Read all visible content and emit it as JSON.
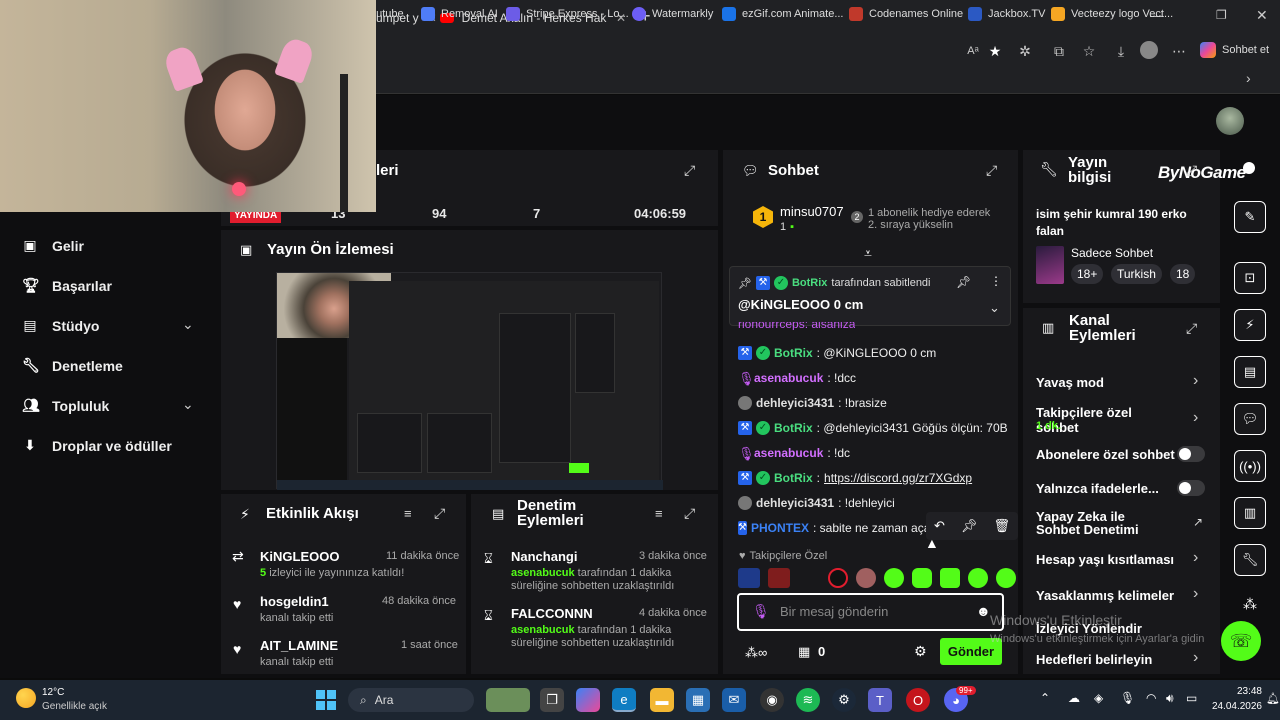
{
  "browser": {
    "tabs": [
      {
        "label": "umpet y"
      },
      {
        "label": "Demet Akalın - Herkes Hak Ettiği G"
      }
    ],
    "copilot_label": "Sohbet et",
    "bookmarks": [
      "outube",
      "Removal.AI",
      "Stripe Express - Lo...",
      "Watermarkly",
      "ezGif.com Animate...",
      "Codenames Online",
      "Jackbox.TV",
      "Vecteezy logo Vect..."
    ]
  },
  "sidebar": {
    "items": [
      {
        "label": "Gelir"
      },
      {
        "label": "Başarılar"
      },
      {
        "label": "Stüdyo"
      },
      {
        "label": "Denetleme"
      },
      {
        "label": "Topluluk"
      },
      {
        "label": "Droplar ve ödüller"
      }
    ]
  },
  "stats": {
    "title": "leri",
    "live_badge": "YAYINDA",
    "values": [
      "13",
      "94",
      "7",
      "04:06:59"
    ]
  },
  "preview": {
    "title": "Yayın Ön İzlemesi"
  },
  "chat": {
    "title": "Sohbet",
    "leader_name": "minsu0707",
    "leader_count": "1",
    "leader_rank": "1",
    "gift_line1": "1 abonelik hediye ederek",
    "gift_line2": "2. sıraya yükselin",
    "pinned_by": "BotRix",
    "pinned_suffix": "tarafından sabitlendi",
    "pinned_message": "@KiNGLEOOO 0 cm",
    "partial_line": "rionourrceps: alsaniza",
    "messages": [
      {
        "user": "BotRix",
        "text": ": @KiNGLEOOO 0 cm",
        "kind": "bot"
      },
      {
        "user": "asenabucuk",
        "text": ": !dcc",
        "kind": "pink"
      },
      {
        "user": "dehleyici3431",
        "text": ": !brasize",
        "kind": "white"
      },
      {
        "user": "BotRix",
        "text": ": @dehleyici3431 Göğüs ölçün: 70B",
        "kind": "bot"
      },
      {
        "user": "asenabucuk",
        "text": ": !dc",
        "kind": "pink"
      },
      {
        "user": "BotRix",
        "text": ": ",
        "link": "https://discord.gg/zr7XGdxp",
        "kind": "bot"
      },
      {
        "user": "dehleyici3431",
        "text": ": !dehleyici",
        "kind": "white"
      },
      {
        "user": "PHONTEX",
        "text": ": sabite ne zaman açar",
        "kind": "blue"
      }
    ],
    "followers_only": "Takipçilere Özel",
    "input_placeholder": "Bir mesaj gönderin",
    "points": "0",
    "send_label": "Gönder"
  },
  "stream_info": {
    "title": "Yayın bilgisi",
    "logo_text": "ByNoGame",
    "stream_title": "isim şehir kumral 190 erko falan",
    "category": "Sadece Sohbet",
    "tags": [
      "18+",
      "Turkish",
      "18"
    ]
  },
  "channel_actions": {
    "title": "Kanal Eylemleri",
    "items": [
      {
        "label": "Yavaş mod",
        "control": "chevron"
      },
      {
        "label": "Takipçilere özel sohbet",
        "sub": "1 dk.",
        "control": "chevron"
      },
      {
        "label": "Abonelere özel sohbet",
        "control": "toggle"
      },
      {
        "label": "Yalnızca ifadelerle...",
        "control": "toggle"
      },
      {
        "label": "Yapay Zeka ile Sohbet Denetimi",
        "control": "external"
      },
      {
        "label": "Hesap yaşı kısıtlaması",
        "control": "chevron"
      },
      {
        "label": "Yasaklanmış kelimeler",
        "control": "chevron"
      },
      {
        "label": "İzleyici Yönlendir",
        "control": "none"
      },
      {
        "label": "Hedefleri belirleyin",
        "control": "chevron"
      }
    ]
  },
  "activity": {
    "title": "Etkinlik Akışı",
    "items": [
      {
        "name": "KiNGLEOOO",
        "time": "11 dakika önce",
        "highlight": "5",
        "sub": "izleyici ile yayınınıza katıldı!"
      },
      {
        "name": "hosgeldin1",
        "time": "48 dakika önce",
        "highlight": "",
        "sub": "kanalı takip etti"
      },
      {
        "name": "AIT_LAMINE",
        "time": "1 saat önce",
        "highlight": "",
        "sub": "kanalı takip etti"
      }
    ]
  },
  "mod_actions": {
    "title": "Denetim Eylemleri",
    "items": [
      {
        "name": "Nanchangi",
        "time": "3 dakika önce",
        "mod": "asenabucuk",
        "sub": "tarafından 1 dakika süreliğine sohbetten uzaklaştırıldı"
      },
      {
        "name": "FALCCONNN",
        "time": "4 dakika önce",
        "mod": "asenabucuk",
        "sub": "tarafından 1 dakika süreliğine sohbetten uzaklaştırıldı"
      }
    ]
  },
  "windows_watermark": {
    "line1": "Windows'u Etkinleştir",
    "line2": "Windows'u etkinleştirmek için Ayarlar'a gidin"
  },
  "taskbar": {
    "temp": "12°C",
    "weather": "Genellikle açık",
    "search": "Ara",
    "time": "23:48",
    "date": "24.04.2026",
    "badge": "99+"
  },
  "colors": {
    "accent": "#53fc18",
    "live": "#e11d2e",
    "bot": "#4ade80",
    "pink": "#d26fff",
    "link": "#3b82f6"
  }
}
